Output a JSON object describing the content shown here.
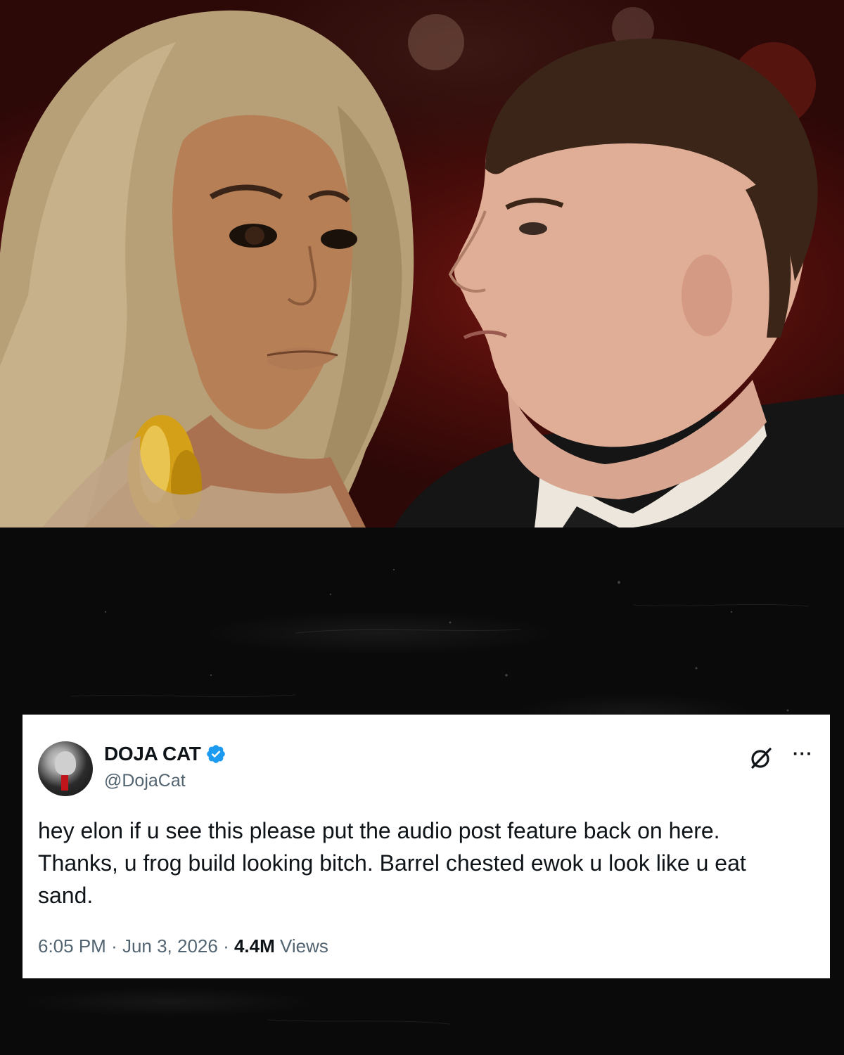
{
  "tweet": {
    "display_name": "DOJA CAT",
    "handle": "@DojaCat",
    "verified": true,
    "text": "hey elon if u see this please put the audio post feature back on here. Thanks, u frog build looking bitch. Barrel chested ewok u look like u eat sand.",
    "time": "6:05 PM",
    "separator": "·",
    "date": "Jun 3, 2026",
    "views_count": "4.4M",
    "views_label": "Views",
    "more_label": "···"
  },
  "icons": {
    "avatar": "avatar",
    "verified": "verified-badge-icon",
    "grok": "grok-icon",
    "more": "more-options-icon"
  },
  "colors": {
    "verified_blue": "#1d9bf0",
    "text_primary": "#0f1419",
    "text_secondary": "#536471",
    "background_red": "#6a1410",
    "card_bg": "#ffffff"
  }
}
